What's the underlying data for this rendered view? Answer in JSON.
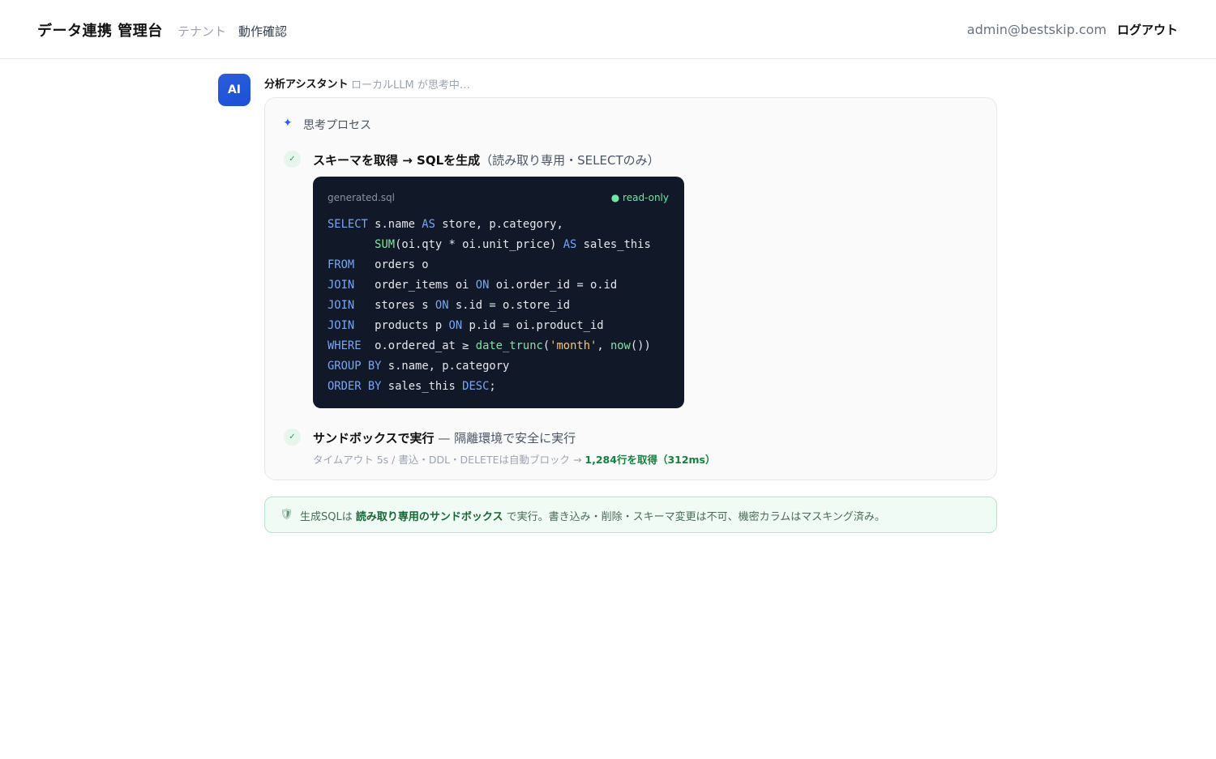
{
  "header": {
    "brand": "データ連携 管理台",
    "nav": [
      "テナント",
      "動作確認"
    ],
    "user_email": "admin@bestskip.com",
    "logout_label": "ログアウト"
  },
  "assistant": {
    "avatar": "AI",
    "name": "分析アシスタント",
    "status": "ローカルLLM が思考中…"
  },
  "process": {
    "title": "思考プロセス",
    "icon": "sparkle-icon",
    "step1": {
      "check": "✓",
      "title_a": "スキーマを取得",
      "arrow": " → ",
      "title_b": "SQLを生成",
      "note": "（読み取り専用・SELECTのみ）"
    },
    "code": {
      "filename": "generated.sql",
      "badge": "● read-only",
      "lines": [
        "SELECT s.name AS store, p.category,",
        "       SUM(oi.qty * oi.unit_price) AS sales_this",
        "FROM   orders o",
        "JOIN   order_items oi ON oi.order_id = o.id",
        "JOIN   stores s ON s.id = o.store_id",
        "JOIN   products p ON p.id = oi.product_id",
        "WHERE  o.ordered_at ≥ date_trunc('month', now())",
        "GROUP BY s.name, p.category",
        "ORDER BY sales_this DESC;"
      ]
    },
    "step2": {
      "check": "✓",
      "title": "サンドボックスで実行",
      "note": " — 隔離環境で安全に実行",
      "meta_prefix": "タイムアウト 5s / 書込・DDL・DELETEは自動ブロック → ",
      "meta_result": "1,284行を取得（312ms）"
    }
  },
  "notice": {
    "icon": "shield-icon",
    "prefix": "生成SQLは",
    "highlight": "読み取り専用のサンドボックス",
    "suffix": "で実行。書き込み・削除・スキーマ変更は不可、機密カラムはマスキング済み。"
  },
  "colors": {
    "accent": "#2563eb",
    "success": "#15803d",
    "code_bg": "#111827"
  }
}
